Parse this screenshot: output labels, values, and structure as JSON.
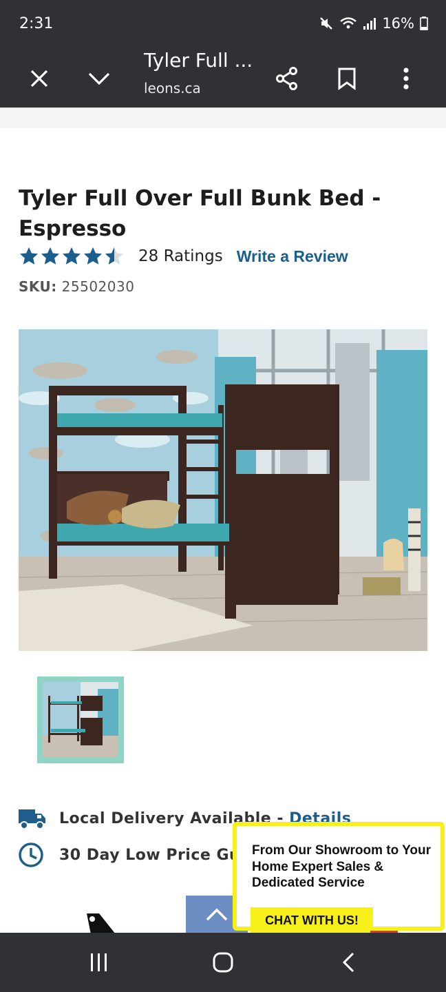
{
  "status_bar": {
    "time": "2:31",
    "battery": "16%",
    "icons": [
      "mute-icon",
      "wifi-icon",
      "signal-icon",
      "battery-icon"
    ]
  },
  "toolbar": {
    "title": "Tyler Full ...",
    "url": "leons.ca",
    "icons": [
      "close-icon",
      "chevron-down-icon",
      "share-icon",
      "bookmark-icon",
      "more-vert-icon"
    ]
  },
  "product": {
    "title": "Tyler Full Over Full Bunk Bed - Espresso",
    "rating": 4.5,
    "rating_max": 5,
    "ratings_count": "28 Ratings",
    "write_review": "Write a Review",
    "sku_label": "SKU:",
    "sku_value": "25502030"
  },
  "features": {
    "delivery": "Local Delivery Available - ",
    "delivery_link": "Details",
    "price": "30 Day Low Price Gu"
  },
  "chat": {
    "message": "From Our Showroom to Your Home Expert Sales & Dedicated Service",
    "button": "CHAT WITH US!"
  },
  "colors": {
    "system_bar": "#303134",
    "link": "#1a5e8e",
    "star": "#1b5d8c",
    "chat_highlight": "#f7f01a",
    "thumb_border": "#8fd5c5",
    "scroll_button": "#6c8ec2"
  }
}
